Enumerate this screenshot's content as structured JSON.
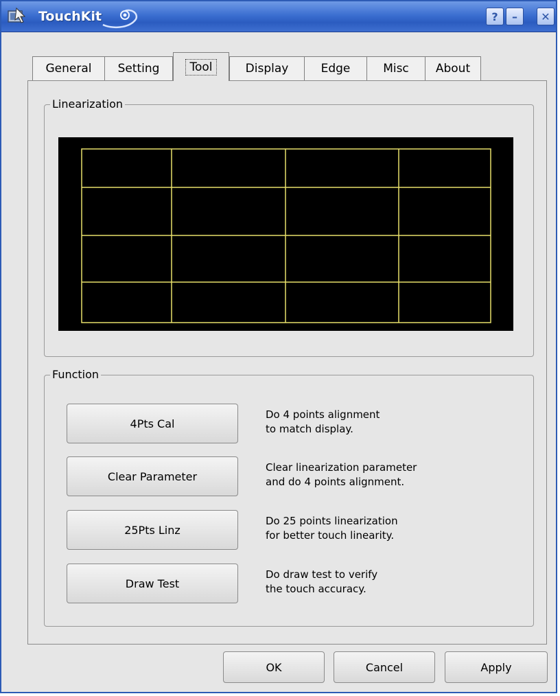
{
  "window": {
    "title": "TouchKit",
    "buttons": {
      "help": "?",
      "minimize": "–",
      "close": "✕"
    }
  },
  "tabs": [
    {
      "label": "General"
    },
    {
      "label": "Setting"
    },
    {
      "label": "Tool",
      "active": true
    },
    {
      "label": "Display"
    },
    {
      "label": "Edge"
    },
    {
      "label": "Misc"
    },
    {
      "label": "About"
    }
  ],
  "linearization": {
    "label": "Linearization",
    "grid_color": "#e8e06a",
    "background_color": "#000000",
    "columns": 4,
    "rows": 4
  },
  "function": {
    "label": "Function",
    "items": [
      {
        "button": "4Pts Cal",
        "desc_line1": "Do 4 points alignment",
        "desc_line2": "to match display."
      },
      {
        "button": "Clear Parameter",
        "desc_line1": "Clear linearization parameter",
        "desc_line2": "and do 4 points alignment."
      },
      {
        "button": "25Pts Linz",
        "desc_line1": "Do 25 points linearization",
        "desc_line2": "for better touch linearity."
      },
      {
        "button": "Draw Test",
        "desc_line1": "Do draw test to verify",
        "desc_line2": "the touch accuracy."
      }
    ]
  },
  "footer": {
    "ok": "OK",
    "cancel": "Cancel",
    "apply": "Apply"
  }
}
